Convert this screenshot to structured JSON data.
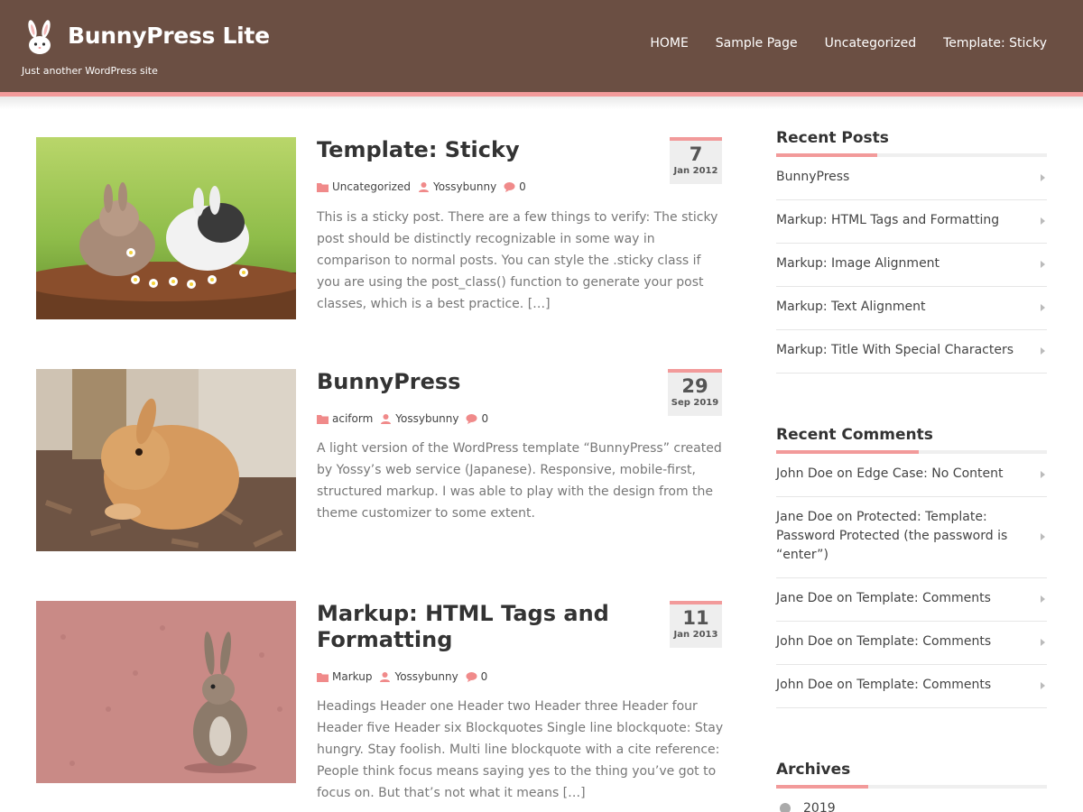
{
  "site": {
    "title": "BunnyPress Lite",
    "description": "Just another WordPress site",
    "logo_icon": "rabbit-logo-icon"
  },
  "nav": {
    "items": [
      {
        "label": "HOME"
      },
      {
        "label": "Sample Page"
      },
      {
        "label": "Uncategorized"
      },
      {
        "label": "Template: Sticky"
      }
    ]
  },
  "posts": [
    {
      "title": "Template: Sticky",
      "day": "7",
      "monthyear": "Jan 2012",
      "category": "Uncategorized",
      "author": "Yossybunny",
      "comments": "0",
      "excerpt": "This is a sticky post. There are a few things to verify: The sticky post should be distinctly recognizable in some way in comparison to normal posts. You can style the .sticky class if you are using the post_class() function to generate your post classes, which is a best practice. […]"
    },
    {
      "title": "BunnyPress",
      "day": "29",
      "monthyear": "Sep 2019",
      "category": "aciform",
      "author": "Yossybunny",
      "comments": "0",
      "excerpt": "A light version of the WordPress template “BunnyPress” created by Yossy’s web service (Japanese). Responsive, mobile-first, structured markup. I was able to play with the design from the theme customizer to some extent."
    },
    {
      "title": "Markup: HTML Tags and Formatting",
      "day": "11",
      "monthyear": "Jan 2013",
      "category": "Markup",
      "author": "Yossybunny",
      "comments": "0",
      "excerpt": "Headings Header one Header two Header three Header four Header five Header six Blockquotes Single line blockquote: Stay hungry. Stay foolish. Multi line blockquote with a cite reference: People think focus means saying yes to the thing you’ve got to focus on. But that’s not what it means […]"
    }
  ],
  "sidebar": {
    "recent_posts": {
      "title": "Recent Posts",
      "items": [
        "BunnyPress",
        "Markup: HTML Tags and Formatting",
        "Markup: Image Alignment",
        "Markup: Text Alignment",
        "Markup: Title With Special Characters"
      ]
    },
    "recent_comments": {
      "title": "Recent Comments",
      "items": [
        "John Doe on Edge Case: No Content",
        "Jane Doe on Protected: Template: Password Protected (the password is “enter”)",
        "Jane Doe on Template: Comments",
        "John Doe on Template: Comments",
        "John Doe on Template: Comments"
      ]
    },
    "archives": {
      "title": "Archives",
      "items": [
        "2019"
      ]
    }
  },
  "colors": {
    "header_bg": "#6b4f43",
    "accent": "#f29a9a",
    "icon_pink": "#f08a8a"
  }
}
